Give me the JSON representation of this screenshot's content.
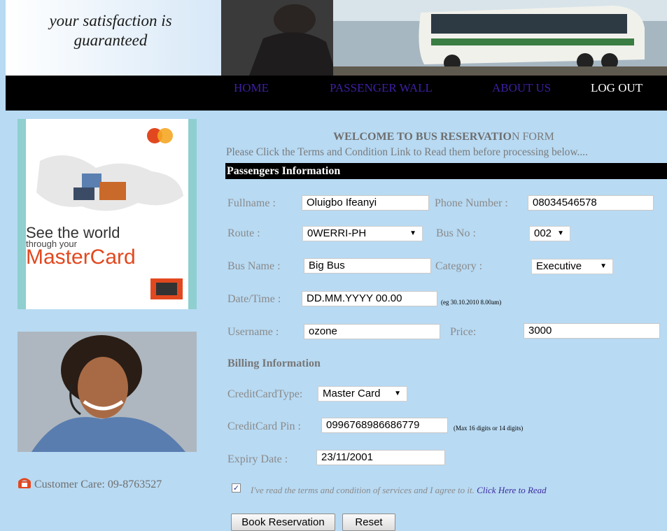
{
  "header": {
    "slogan_line1": "your satisfaction is",
    "slogan_line2": "guaranteed"
  },
  "nav": {
    "home": "HOME",
    "passenger_wall": "PASSENGER WALL",
    "about_us": "ABOUT US",
    "log_out": "LOG OUT"
  },
  "sidebar": {
    "ad_line1": "See the world",
    "ad_line2": "through your",
    "ad_brand": "MasterCard",
    "customer_care": "Customer Care: 09-8763527"
  },
  "form": {
    "title_bold": "WELCOME TO BUS RESERVATIO",
    "title_rest": "N FORM",
    "instructions": "Please Click the Terms and Condition Link to Read them before processing below....",
    "section_title": "Passengers Information",
    "fullname_label": "Fullname :",
    "fullname_value": "Oluigbo Ifeanyi",
    "phone_label": "Phone Number :",
    "phone_value": "08034546578",
    "route_label": "Route :",
    "route_value": "0WERRI-PH",
    "busno_label": "Bus No :",
    "busno_value": "002",
    "busname_label": "Bus Name :",
    "busname_value": "Big Bus",
    "category_label": "Category :",
    "category_value": "Executive",
    "datetime_label": "Date/Time :",
    "datetime_value": "DD.MM.YYYY 00.00",
    "datetime_hint": "(eg 30.10.2010 8.00am)",
    "username_label": "Username :",
    "username_value": "ozone",
    "price_label": "Price:",
    "price_value": "3000",
    "billing_title": "Billing Information",
    "cctype_label": "CreditCardType:",
    "cctype_value": "Master Card",
    "ccpin_label": "CreditCard Pin :",
    "ccpin_value": "0996768986686779",
    "ccpin_hint": "(Max 16 digits or 14 digits)",
    "expiry_label": "Expiry Date :",
    "expiry_value": "23/11/2001",
    "agree_text": "I've read the terms and condition of services and I agree to it.",
    "agree_link": "Click Here to Read",
    "agree_checked": true,
    "book_button": "Book Reservation",
    "reset_button": "Reset"
  },
  "colors": {
    "page_bg": "#b8daf3",
    "nav_link": "#3f1fa6",
    "nav_bar": "#000000",
    "mastercard_red": "#e2481f"
  },
  "icons": {
    "phone": "phone-icon",
    "dropdown": "chevron-down-icon",
    "checkbox": "checkbox-checked-icon"
  }
}
